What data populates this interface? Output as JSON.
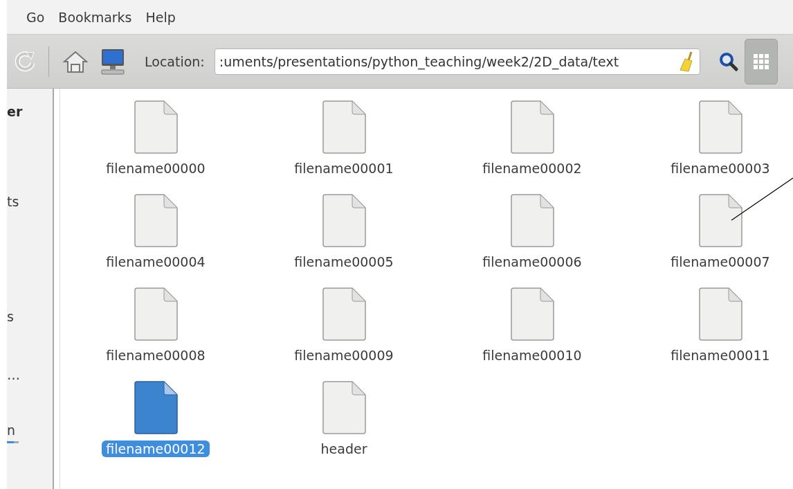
{
  "menu": [
    {
      "label": "Go"
    },
    {
      "label": "Bookmarks"
    },
    {
      "label": "Help"
    }
  ],
  "toolbar": {
    "location_label": "Location:",
    "location": ":uments/presentations/python_teaching/week2/2D_data/text",
    "icon_view_selected": true
  },
  "sidebar": {
    "items": [
      {
        "label": "er",
        "kind": "heading"
      },
      {
        "label": "ts",
        "kind": "place"
      },
      {
        "label": "s",
        "kind": "place"
      },
      {
        "label": "…",
        "kind": "place"
      },
      {
        "label": "n",
        "kind": "device",
        "level": 0.6
      }
    ]
  },
  "files": [
    {
      "name": "filename00000",
      "selected": false
    },
    {
      "name": "filename00001",
      "selected": false
    },
    {
      "name": "filename00002",
      "selected": false
    },
    {
      "name": "filename00003",
      "selected": false
    },
    {
      "name": "filename00004",
      "selected": false
    },
    {
      "name": "filename00005",
      "selected": false
    },
    {
      "name": "filename00006",
      "selected": false
    },
    {
      "name": "filename00007",
      "selected": false
    },
    {
      "name": "filename00008",
      "selected": false
    },
    {
      "name": "filename00009",
      "selected": false
    },
    {
      "name": "filename00010",
      "selected": false
    },
    {
      "name": "filename00011",
      "selected": false
    },
    {
      "name": "filename00012",
      "selected": true
    },
    {
      "name": "header",
      "selected": false
    }
  ]
}
